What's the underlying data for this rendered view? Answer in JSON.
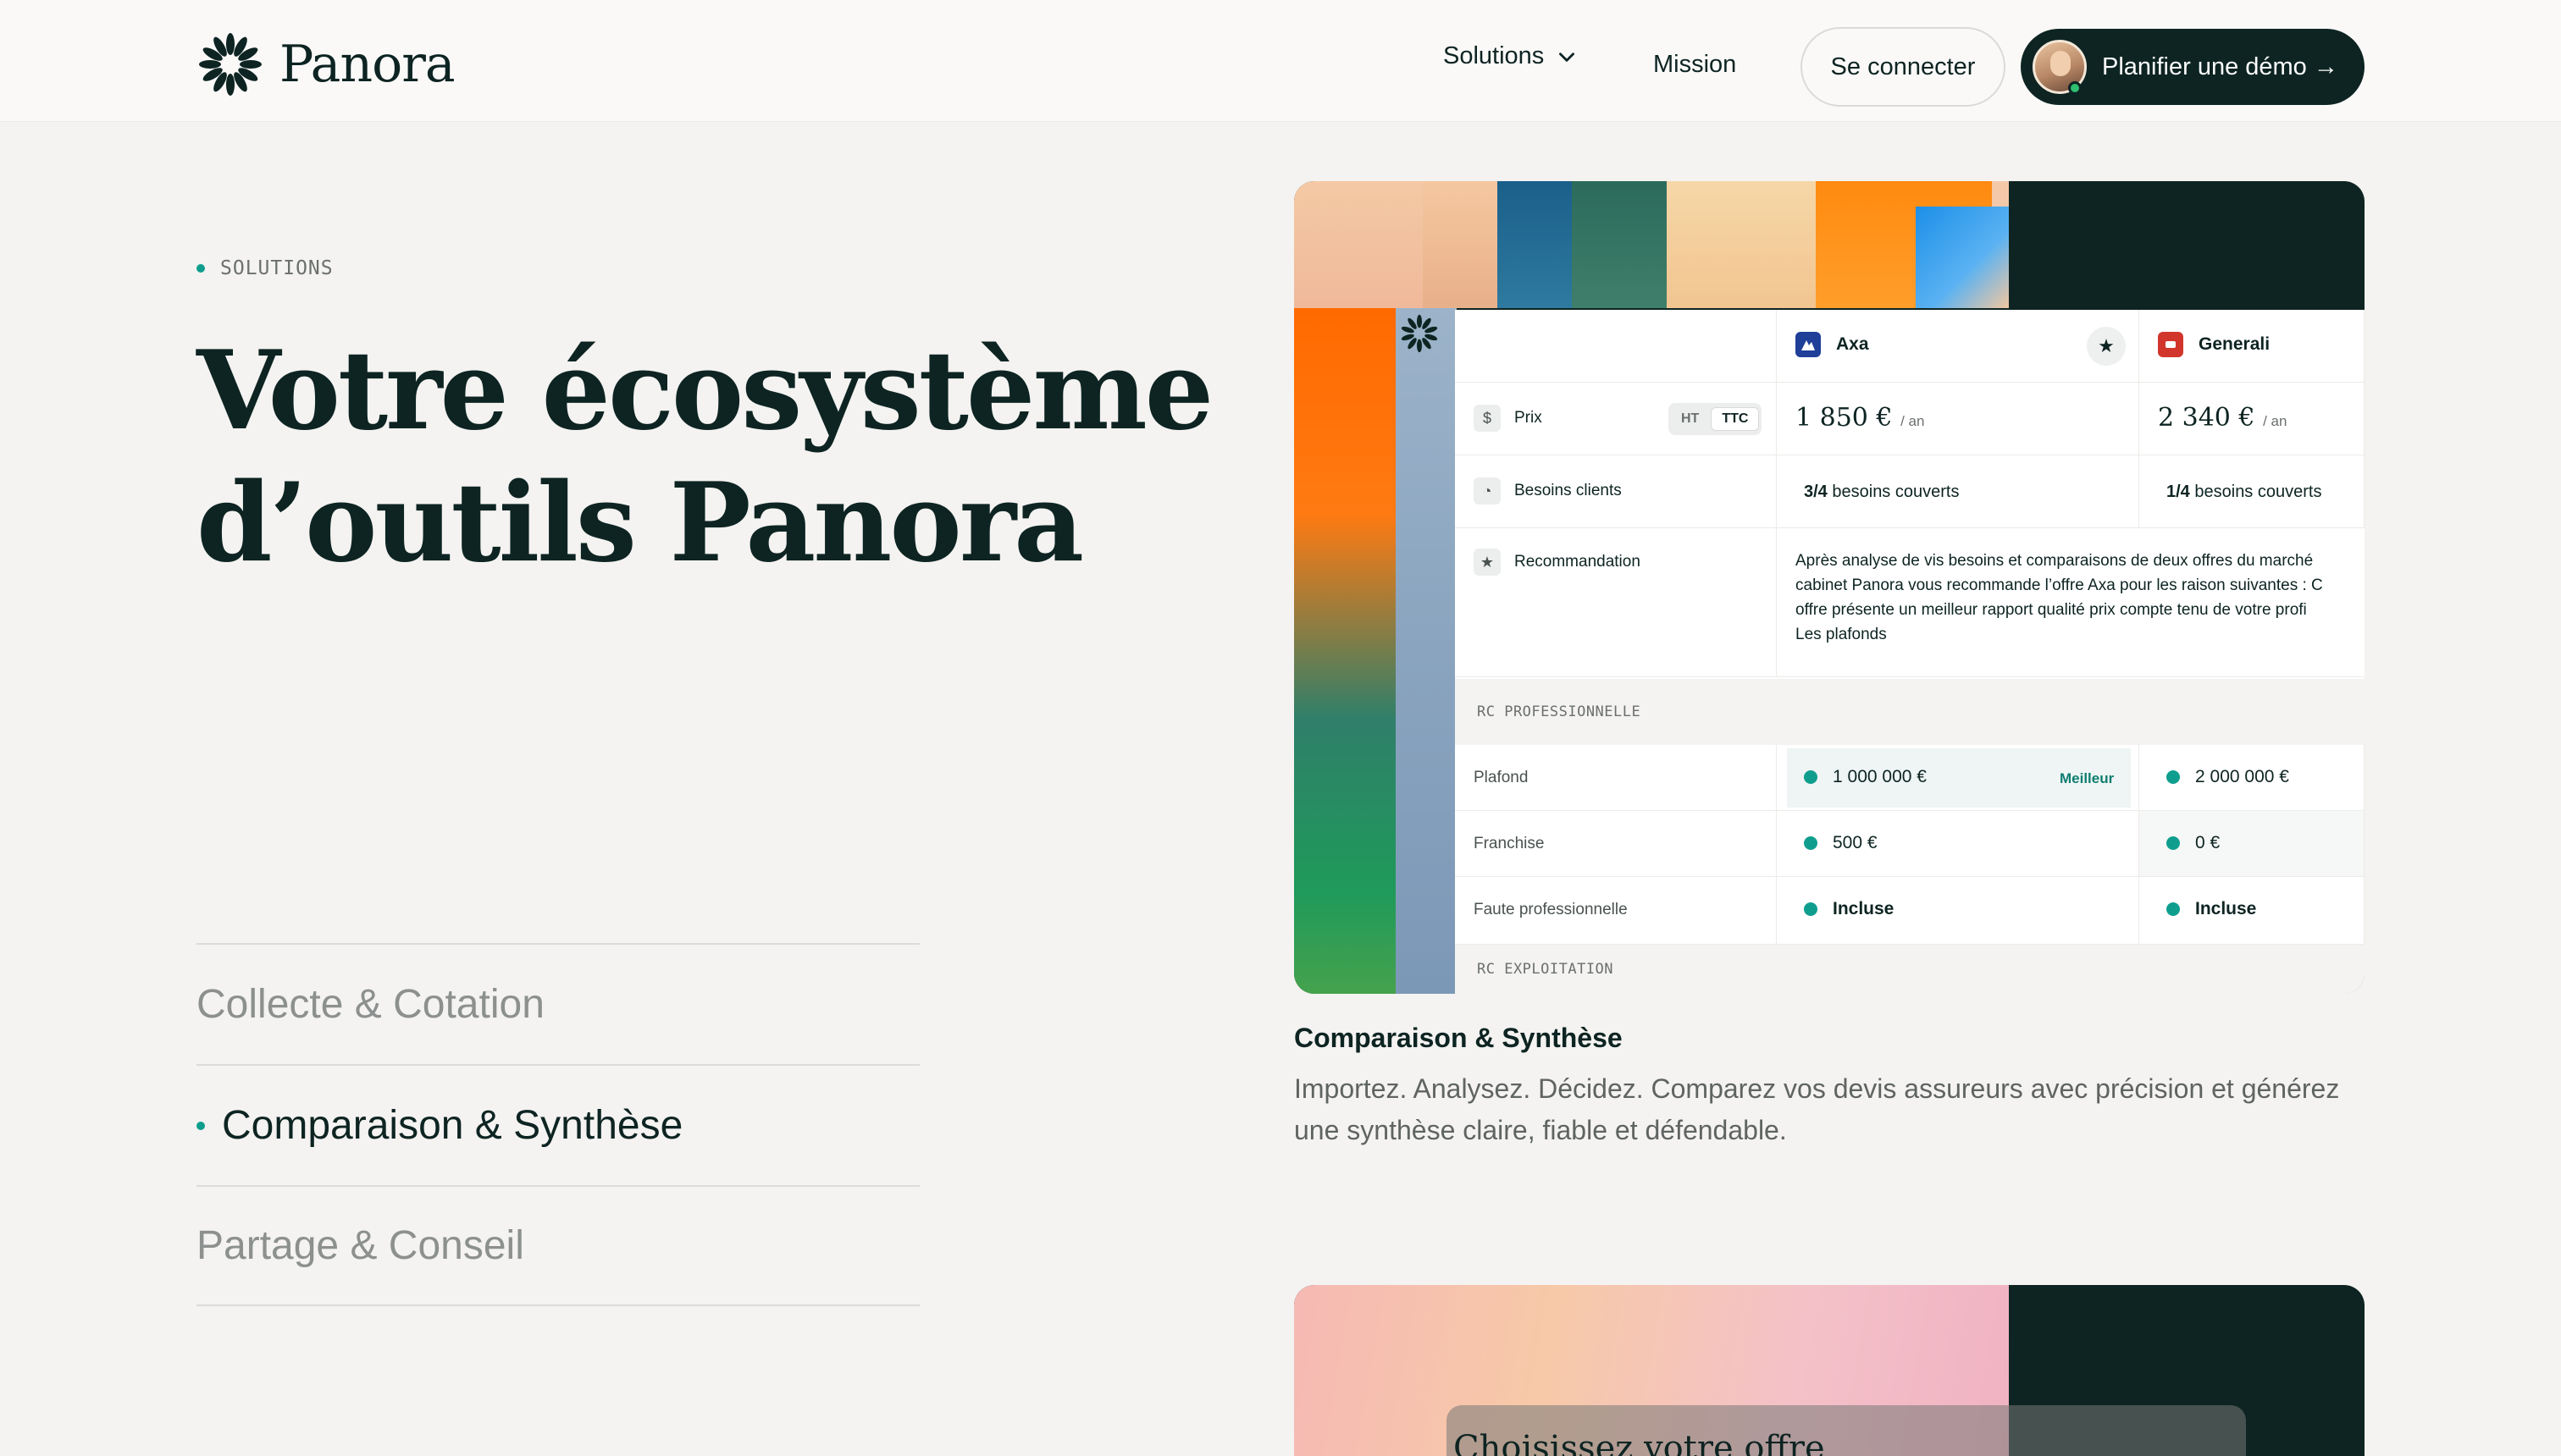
{
  "brand": {
    "name": "Panora"
  },
  "nav": {
    "solutions": "Solutions",
    "mission": "Mission",
    "login": "Se connecter",
    "demo": "Planifier une démo →"
  },
  "hero": {
    "eyebrow": "SOLUTIONS",
    "title_line1": "Votre écosystème",
    "title_line2": "d’outils Panora"
  },
  "steps": [
    {
      "label": "Collecte & Cotation",
      "active": false
    },
    {
      "label": "Comparaison & Synthèse",
      "active": true
    },
    {
      "label": "Partage & Conseil",
      "active": false
    }
  ],
  "comparison": {
    "insurers": [
      {
        "name": "Axa",
        "color": "#1f3f99"
      },
      {
        "name": "Generali",
        "color": "#d2352b"
      }
    ],
    "price": {
      "label": "Prix",
      "toggle": [
        "HT",
        "TTC"
      ],
      "axa": "1 850 €",
      "generali": "2 340 €",
      "unit": "/ an"
    },
    "needs": {
      "label": "Besoins clients",
      "axa_count": "3/4",
      "generali_count": "1/4",
      "suffix": "besoins couverts"
    },
    "recommendation": {
      "label": "Recommandation",
      "lines": [
        "Après analyse de vis besoins et comparaisons de deux offres du marché",
        "cabinet Panora vous recommande l’offre Axa pour les raison suivantes : C",
        "offre présente un meilleur rapport qualité prix compte tenu de votre profi",
        "Les plafonds"
      ]
    },
    "sections": {
      "rc_pro": "RC PROFESSIONNELLE",
      "rc_exploit": "RC EXPLOITATION"
    },
    "rows": [
      {
        "label": "Plafond",
        "axa": "1 000 000 €",
        "generali": "2 000 000 €",
        "best": "Meilleur"
      },
      {
        "label": "Franchise",
        "axa": "500 €",
        "generali": "0 €"
      },
      {
        "label": "Faute professionnelle",
        "axa": "Incluse",
        "generali": "Incluse"
      }
    ]
  },
  "caption": {
    "title": "Comparaison & Synthèse",
    "text": "Importez. Analysez. Décidez. Comparez vos devis assureurs avec précision et générez une synthèse claire, fiable et défendable."
  },
  "card2": {
    "title": "Choisissez votre offre"
  },
  "colors": {
    "dark": "#0d2422",
    "accent": "#0f9e8e",
    "background": "#f4f3f1"
  }
}
